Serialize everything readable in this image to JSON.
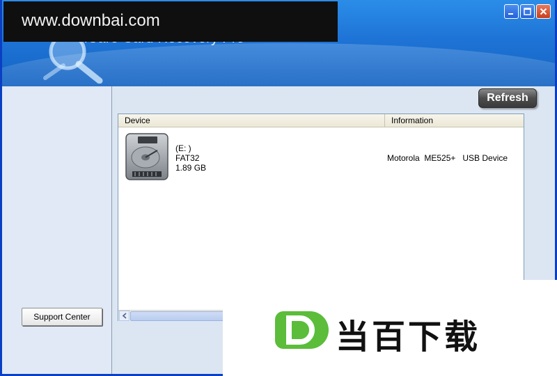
{
  "watermark": {
    "text": "www.downbai.com"
  },
  "app": {
    "title": "iCare Card Recovery Pro"
  },
  "toolbar": {
    "refresh_label": "Refresh"
  },
  "sidebar": {
    "support_label": "Support Center"
  },
  "device_list": {
    "columns": [
      "Device",
      "Information"
    ],
    "rows": [
      {
        "drive": "(E: )",
        "filesystem": "FAT32",
        "size": "1.89 GB",
        "info": "Motorola  ME525+   USB Device"
      }
    ]
  },
  "logo": {
    "letter": "D",
    "text": "当百下载",
    "color": "#5bbd3a"
  },
  "colors": {
    "title_bar": "#1e74d6",
    "frame": "#0a3fc4",
    "close": "#c6401d"
  }
}
